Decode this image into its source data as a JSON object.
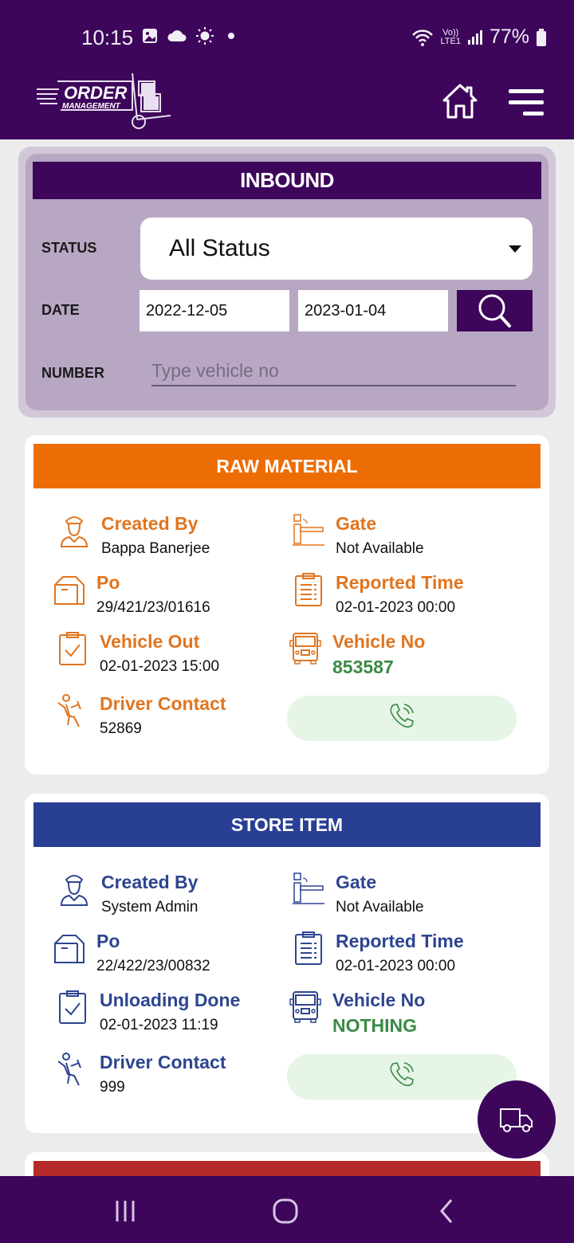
{
  "status_bar": {
    "time": "10:15",
    "battery": "77%",
    "network": "LTE1",
    "volte": "Vo))"
  },
  "header": {
    "logo_line1": "ORDER",
    "logo_line2": "MANAGEMENT",
    "home_icon": "home-icon",
    "menu_icon": "menu-icon"
  },
  "filter": {
    "title": "INBOUND",
    "status_label": "STATUS",
    "status_value": "All Status",
    "date_label": "DATE",
    "date_from": "2022-12-05",
    "date_to": "2023-01-04",
    "number_label": "NUMBER",
    "number_placeholder": "Type vehicle no",
    "number_value": ""
  },
  "cards": [
    {
      "title": "RAW MATERIAL",
      "header_color": "#ed6d05",
      "label_color": "#e07520",
      "created_by_label": "Created By",
      "created_by": "Bappa Banerjee",
      "gate_label": "Gate",
      "gate": "Not Available",
      "po_label": "Po",
      "po": "29/421/23/01616",
      "reported_label": "Reported Time",
      "reported": "02-01-2023 00:00",
      "status_label": "Vehicle Out",
      "status_value": "02-01-2023 15:00",
      "vehicle_label": "Vehicle No",
      "vehicle": "853587",
      "driver_label": "Driver Contact",
      "driver": "52869"
    },
    {
      "title": "STORE ITEM",
      "header_color": "#283f94",
      "label_color": "#2d4590",
      "created_by_label": "Created By",
      "created_by": "System Admin",
      "gate_label": "Gate",
      "gate": "Not Available",
      "po_label": "Po",
      "po": "22/422/23/00832",
      "reported_label": "Reported Time",
      "reported": "02-01-2023 00:00",
      "status_label": "Unloading Done",
      "status_value": "02-01-2023 11:19",
      "vehicle_label": "Vehicle No",
      "vehicle": "NOTHING",
      "driver_label": "Driver Contact",
      "driver": "999"
    }
  ],
  "partial_card": {
    "header_color": "#b52b2b"
  },
  "colors": {
    "primary": "#3d065b",
    "call_bg": "#e6f5e6",
    "call_icon": "#3a8a45"
  }
}
